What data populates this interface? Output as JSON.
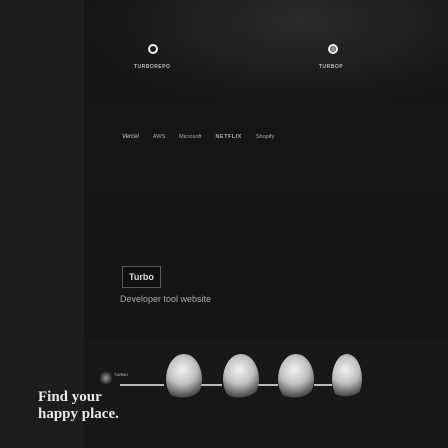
{
  "hero": {
    "wordmarks": [
      "TURBOREPO",
      "TURBOP"
    ],
    "logos": [
      "Vercel",
      "AWS",
      "Microsoft",
      "NETFLIX",
      "Shopify"
    ]
  },
  "turbo": {
    "badge": "Turbo",
    "tagline": "Developer tool website"
  },
  "bottom": {
    "tag": "TURBO",
    "headline_line1": "Find your",
    "headline_line2": "happy place."
  },
  "colors": {
    "background": "#1d1d1d",
    "card": "#151515",
    "text": "#e8e8e8"
  }
}
